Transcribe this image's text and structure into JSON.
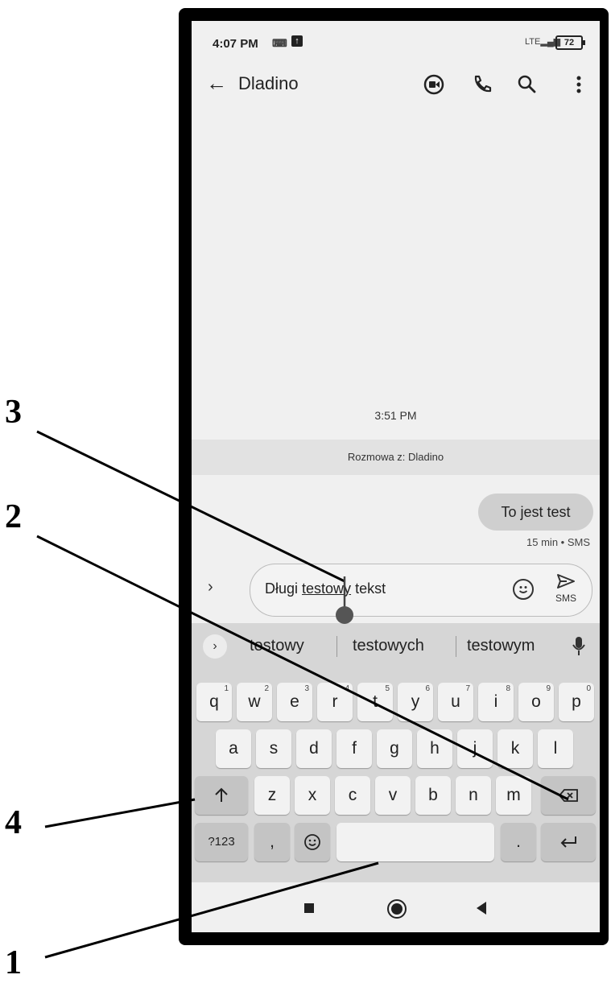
{
  "callouts": {
    "c1": "1",
    "c2": "2",
    "c3": "3",
    "c4": "4"
  },
  "status": {
    "time": "4:07 PM",
    "network": "LTE",
    "battery": "72"
  },
  "appbar": {
    "title": "Dladino"
  },
  "conversation": {
    "timestamp": "3:51 PM",
    "header": "Rozmowa z: Dladino",
    "message": {
      "text": "To jest test",
      "meta": "15 min • SMS"
    }
  },
  "compose": {
    "text_before": "Długi ",
    "text_underlined": "testowy",
    "text_after": " tekst",
    "send_label": "SMS"
  },
  "suggestions": [
    "testowy",
    "testowych",
    "testowym"
  ],
  "keyboard": {
    "row1": [
      "q",
      "w",
      "e",
      "r",
      "t",
      "y",
      "u",
      "i",
      "o",
      "p"
    ],
    "row1_hints": [
      "1",
      "2",
      "3",
      "4",
      "5",
      "6",
      "7",
      "8",
      "9",
      "0"
    ],
    "row2": [
      "a",
      "s",
      "d",
      "f",
      "g",
      "h",
      "j",
      "k",
      "l"
    ],
    "row3": [
      "z",
      "x",
      "c",
      "v",
      "b",
      "n",
      "m"
    ],
    "symbols_label": "?123",
    "comma": ",",
    "period": "."
  },
  "icons": {
    "back": "arrow-left-icon",
    "video": "video-call-icon",
    "phone": "phone-icon",
    "search": "search-icon",
    "more": "more-vert-icon",
    "emoji": "emoji-icon",
    "send": "send-icon",
    "mic": "mic-icon",
    "shift": "shift-icon",
    "backspace": "backspace-icon",
    "enter": "enter-icon"
  }
}
